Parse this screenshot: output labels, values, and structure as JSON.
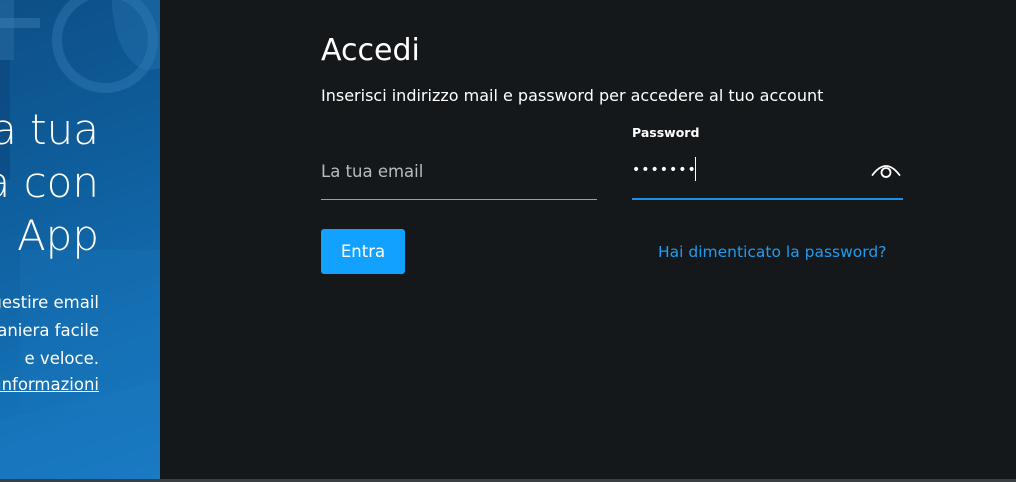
{
  "promo": {
    "title_lines": [
      "a tua",
      "a con",
      "a App"
    ],
    "description_lines": [
      "gestire email",
      "maniera facile",
      "e veloce."
    ],
    "link_label": "informazioni"
  },
  "login": {
    "title": "Accedi",
    "subtitle": "Inserisci indirizzo mail e password per accedere al tuo account",
    "email": {
      "placeholder": "La tua email",
      "value": ""
    },
    "password": {
      "label": "Password",
      "value": "•••••••"
    },
    "submit_label": "Entra",
    "forgot_label": "Hai dimenticato la password?"
  },
  "icons": {
    "reveal_password": "eye-icon"
  },
  "colors": {
    "background": "#15181b",
    "promo_blue": "#0f5f9e",
    "accent": "#12a1ff",
    "link": "#1f9cf0",
    "focus_underline": "#1f8fe6"
  }
}
